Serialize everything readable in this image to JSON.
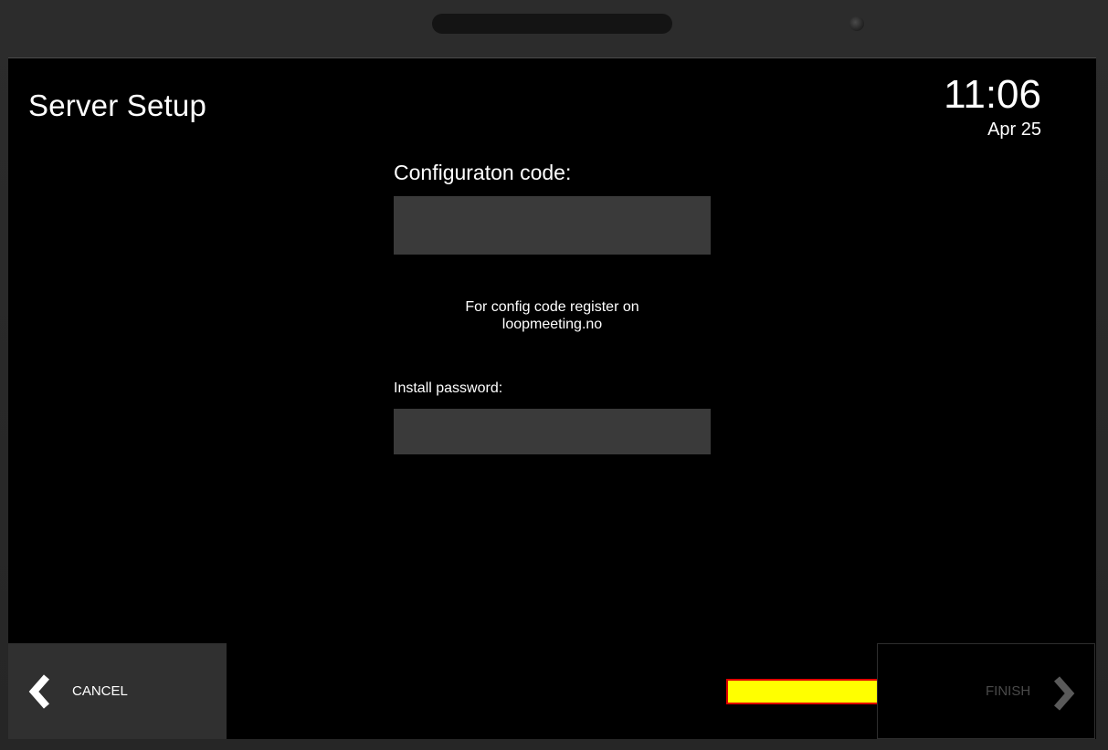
{
  "header": {
    "title": "Server Setup",
    "time": "11:06",
    "date": "Apr 25"
  },
  "form": {
    "config_label": "Configuraton code:",
    "config_value": "",
    "hint_line1": "For config code register on",
    "hint_line2": "loopmeeting.no",
    "password_label": "Install password:",
    "password_value": ""
  },
  "footer": {
    "cancel_label": "CANCEL",
    "finish_label": "FINISH"
  },
  "icons": {
    "cancel": "chevron-left-icon",
    "finish": "chevron-right-icon",
    "annotation": "yellow-arrow-icon"
  },
  "colors": {
    "screen_bg": "#000000",
    "input_bg": "#3a3a3a",
    "cancel_bg": "#303030",
    "finish_text_disabled": "#4a4a4a",
    "annotation_arrow_fill": "#ffff00",
    "annotation_arrow_stroke": "#e00000"
  }
}
